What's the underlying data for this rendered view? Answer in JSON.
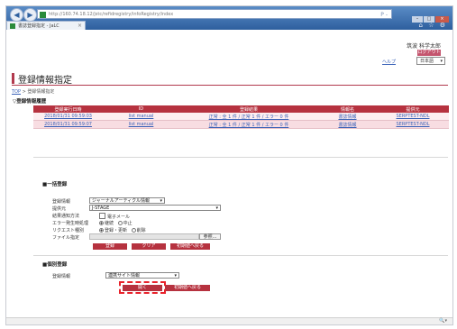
{
  "browser": {
    "url": "http://160.74.18.12/jstc/refidregistry/infoRegistry/index",
    "tab_title": "書誌登録指定 - JaLC",
    "search_hint": "P - ",
    "window_buttons": [
      "–",
      "□",
      "×"
    ]
  },
  "header": {
    "user_name": "筑波 科学太郎",
    "logout_label": "ログアウト",
    "help_label": "ヘルプ",
    "language_value": "日本語"
  },
  "page": {
    "title": "登録情報指定",
    "breadcrumb_top": "TOP",
    "breadcrumb_current": " > 登録情報指定"
  },
  "history": {
    "heading": "▽登録情報履歴",
    "columns": [
      "登録実行日時",
      "ID",
      "登録結果",
      "情報名",
      "提供元"
    ],
    "rows": [
      [
        "2018/01/31 09:59:03",
        "list manual",
        "正常 : 全 1 件 / 正常 1 件 / エラー 0 件",
        "書誌情報",
        "SERPTEST-NDL"
      ],
      [
        "2018/01/31 09:59:07",
        "list manual",
        "正常 : 全 1 件 / 正常 1 件 / エラー 0 件",
        "書誌情報",
        "SERPTEST-NDL"
      ]
    ]
  },
  "bulk": {
    "heading": "■一括登録",
    "info_label": "登録情報",
    "info_value": "ジャーナルアーティクル情報",
    "provider_label": "提供元",
    "provider_value": "J-STAGE",
    "notify_label": "結果通知方法",
    "notify_option": "電子メール",
    "error_label": "エラー発生時処理",
    "error_options": [
      "継続",
      "中止"
    ],
    "request_label": "リクエスト種別",
    "request_options": [
      "登録・更新",
      "削除"
    ],
    "file_label": "ファイル指定",
    "browse_label": "参照...",
    "buttons": [
      "登録",
      "クリア",
      "初期値へ戻る"
    ]
  },
  "single": {
    "heading": "■個別登録",
    "info_label": "登録情報",
    "info_value": "連携サイト情報",
    "buttons": [
      "開く",
      "初期値へ戻る"
    ]
  },
  "colors": {
    "accent": "#b6323f",
    "link": "#3a62b8",
    "highlight": "#e8232c"
  }
}
